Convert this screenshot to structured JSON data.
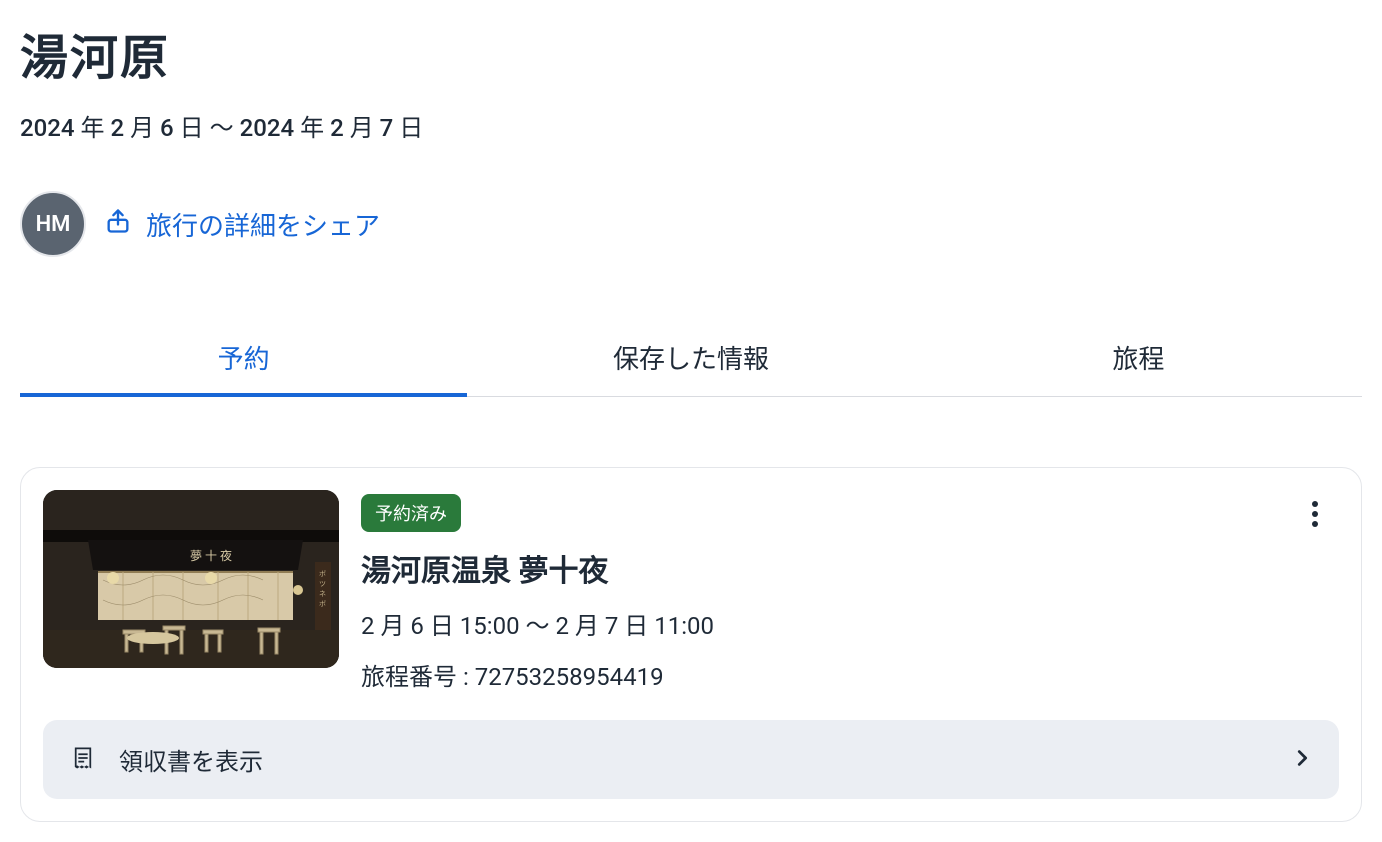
{
  "trip": {
    "title": "湯河原",
    "dateRange": "2024 年 2 月 6 日 〜 2024 年 2 月 7 日"
  },
  "user": {
    "avatarInitials": "HM"
  },
  "share": {
    "label": "旅行の詳細をシェア"
  },
  "tabs": {
    "bookings": "予約",
    "saved": "保存した情報",
    "itinerary": "旅程"
  },
  "booking": {
    "statusBadge": "予約済み",
    "hotelName": "湯河原温泉 夢十夜",
    "checkInOut": "2 月 6 日 15:00 〜 2 月 7 日 11:00",
    "itineraryLabel": "旅程番号 :",
    "itineraryNumber": "72753258954419",
    "receiptLabel": "領収書を表示"
  },
  "colors": {
    "accent": "#1766d6",
    "badge": "#2a7a3b",
    "avatar": "#5a6470"
  }
}
